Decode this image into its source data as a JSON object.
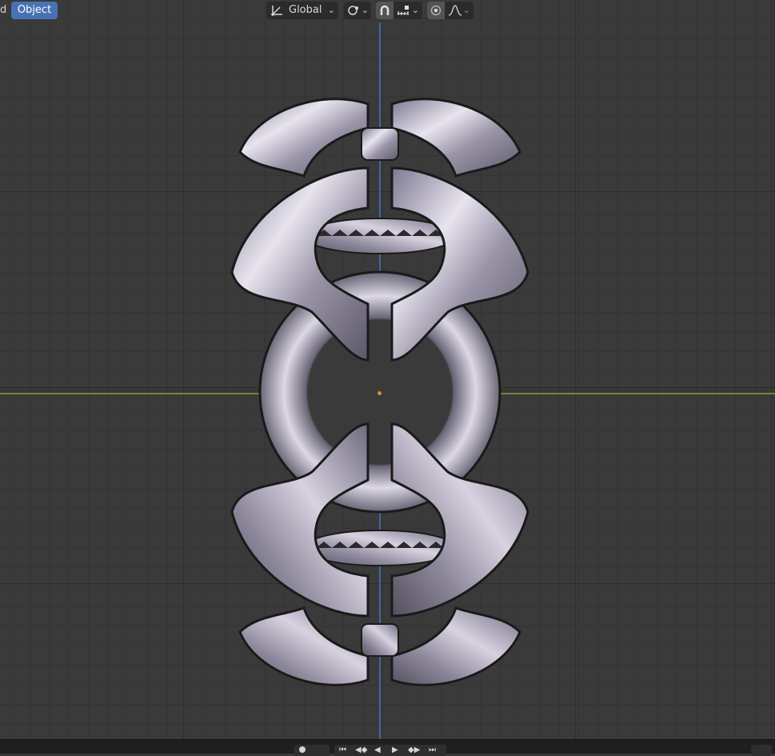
{
  "header": {
    "mode_label_fragment": "d",
    "object_menu_label": "Object",
    "transform_orientation": "Global"
  },
  "icons": {
    "orientation": "transform-orientation-icon",
    "pivot": "pivot-point-icon",
    "snap": "snap-magnet-icon",
    "snap_target": "snap-increment-icon",
    "proportional": "proportional-editing-icon",
    "falloff": "falloff-curve-icon"
  },
  "colors": {
    "active_menu": "#4772b3",
    "x_axis": "#6b8a3a",
    "z_axis": "#3d6a9c",
    "origin": "#e08a2a"
  },
  "footer": {
    "playback_controls": [
      "jump-start",
      "prev-keyframe",
      "play-reverse",
      "play",
      "next-keyframe",
      "jump-end"
    ]
  }
}
